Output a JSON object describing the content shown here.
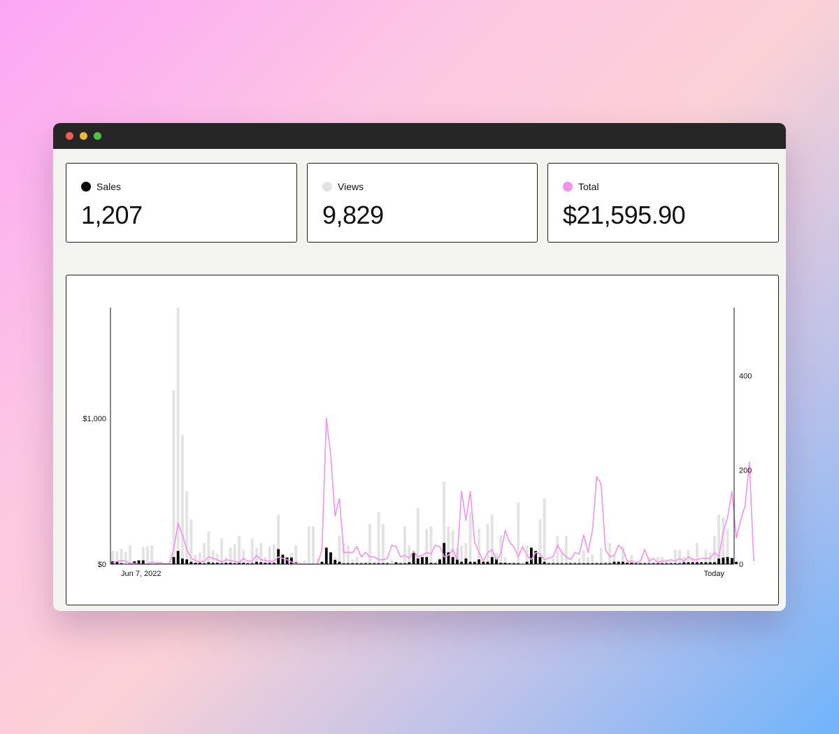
{
  "stats": [
    {
      "label": "Sales",
      "value": "1,207",
      "dot_color": "#0a0a0a"
    },
    {
      "label": "Views",
      "value": "9,829",
      "dot_color": "#e3e3e3"
    },
    {
      "label": "Total",
      "value": "$21,595.90",
      "dot_color": "#f492ea"
    }
  ],
  "chart_data": {
    "type": "bar",
    "x_start_label": "Jun 7, 2022",
    "x_end_label": "Today",
    "left_axis": {
      "ticks": [
        {
          "value": 0,
          "label": "$0"
        },
        {
          "value": 1000,
          "label": "$1,000"
        }
      ],
      "ylim": [
        0,
        1760
      ]
    },
    "right_axis": {
      "ticks": [
        {
          "value": 0,
          "label": "0"
        },
        {
          "value": 200,
          "label": "200"
        },
        {
          "value": 400,
          "label": "400"
        }
      ],
      "ylim": [
        0,
        545
      ]
    },
    "colors": {
      "views": "#e3e3e3",
      "sales": "#0a0a0a",
      "total": "#f492ea"
    },
    "grid": false,
    "legend": "none",
    "views": [
      28,
      27,
      33,
      26,
      40,
      2,
      2,
      36,
      37,
      40,
      5,
      2,
      2,
      2,
      370,
      545,
      275,
      155,
      95,
      20,
      25,
      45,
      70,
      30,
      22,
      55,
      15,
      35,
      42,
      60,
      30,
      4,
      55,
      35,
      45,
      15,
      38,
      42,
      105,
      5,
      15,
      24,
      40,
      4,
      8,
      80,
      80,
      12,
      5,
      5,
      5,
      15,
      60,
      45,
      40,
      10,
      15,
      3,
      5,
      85,
      5,
      110,
      85,
      5,
      10,
      1,
      5,
      80,
      40,
      20,
      120,
      6,
      75,
      80,
      5,
      15,
      175,
      80,
      72,
      35,
      40,
      45,
      110,
      5,
      75,
      6,
      85,
      105,
      24,
      62,
      15,
      4,
      5,
      130,
      5,
      40,
      15,
      15,
      95,
      140,
      6,
      12,
      60,
      25,
      60,
      5,
      5,
      12,
      30,
      15,
      20,
      5,
      35,
      5,
      45,
      20,
      6,
      38,
      6,
      20,
      5,
      5,
      5,
      15,
      5,
      15,
      15,
      10,
      5,
      30,
      30,
      15,
      30,
      15,
      45,
      5,
      30,
      25,
      60,
      105,
      100,
      75,
      5
    ],
    "sales": [
      6,
      6,
      2,
      0,
      2,
      6,
      8,
      8,
      0,
      0,
      0,
      0,
      0,
      0,
      15,
      28,
      12,
      10,
      5,
      3,
      3,
      2,
      4,
      3,
      3,
      2,
      3,
      3,
      2,
      3,
      3,
      2,
      2,
      5,
      4,
      3,
      3,
      3,
      32,
      20,
      14,
      14,
      4,
      0,
      0,
      0,
      0,
      0,
      5,
      35,
      25,
      9,
      5,
      2,
      2,
      2,
      2,
      2,
      2,
      2,
      2,
      2,
      2,
      2,
      0,
      4,
      2,
      2,
      4,
      24,
      12,
      15,
      15,
      3,
      2,
      10,
      45,
      25,
      15,
      10,
      5,
      12,
      5,
      5,
      10,
      5,
      5,
      15,
      12,
      3,
      3,
      2,
      2,
      2,
      0,
      5,
      35,
      28,
      15,
      5,
      2,
      2,
      2,
      2,
      2,
      2,
      2,
      2,
      2,
      2,
      2,
      2,
      2,
      2,
      2,
      5,
      5,
      5,
      3,
      3,
      2,
      2,
      2,
      2,
      2,
      2,
      2,
      2,
      2,
      2,
      2,
      4,
      4,
      4,
      4,
      4,
      4,
      4,
      4,
      12,
      14,
      15,
      13,
      5
    ],
    "total": [
      10,
      18,
      25,
      20,
      5,
      5,
      0,
      0,
      0,
      15,
      5,
      10,
      0,
      5,
      100,
      280,
      200,
      100,
      40,
      25,
      15,
      20,
      50,
      40,
      30,
      15,
      30,
      25,
      20,
      10,
      40,
      20,
      20,
      60,
      30,
      25,
      20,
      20,
      50,
      40,
      30,
      15,
      5,
      0,
      0,
      0,
      0,
      0,
      100,
      1000,
      750,
      330,
      450,
      80,
      80,
      80,
      120,
      50,
      80,
      50,
      50,
      30,
      30,
      40,
      130,
      120,
      50,
      60,
      40,
      90,
      50,
      60,
      80,
      70,
      130,
      120,
      50,
      60,
      100,
      30,
      500,
      300,
      500,
      150,
      80,
      20,
      80,
      100,
      30,
      70,
      230,
      150,
      120,
      50,
      120,
      60,
      30,
      80,
      70,
      30,
      40,
      50,
      130,
      80,
      50,
      30,
      80,
      70,
      200,
      80,
      230,
      600,
      550,
      100,
      50,
      60,
      130,
      100,
      20,
      20,
      10,
      20,
      100,
      20,
      40,
      10,
      20,
      20,
      30,
      20,
      40,
      20,
      50,
      30,
      30,
      40,
      40,
      40,
      80,
      50,
      220,
      320,
      500,
      180,
      300,
      400,
      700,
      20
    ]
  }
}
